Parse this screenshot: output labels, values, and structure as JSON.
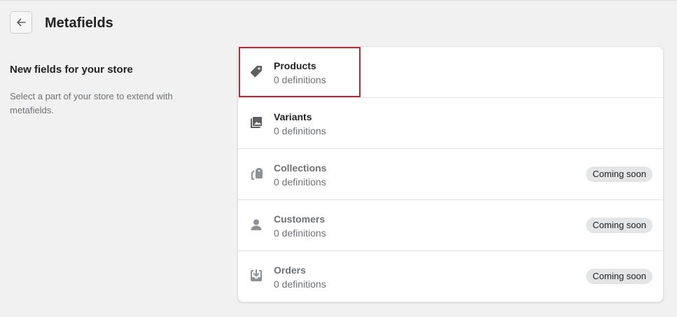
{
  "header": {
    "back_label": "Back",
    "title": "Metafields"
  },
  "section": {
    "heading": "New fields for your store",
    "description": "Select a part of your store to extend with metafields."
  },
  "items": [
    {
      "title": "Products",
      "subtitle": "0 definitions",
      "icon": "tag-icon",
      "enabled": true,
      "badge": ""
    },
    {
      "title": "Variants",
      "subtitle": "0 definitions",
      "icon": "variants-icon",
      "enabled": true,
      "badge": ""
    },
    {
      "title": "Collections",
      "subtitle": "0 definitions",
      "icon": "collections-icon",
      "enabled": false,
      "badge": "Coming soon"
    },
    {
      "title": "Customers",
      "subtitle": "0 definitions",
      "icon": "customer-icon",
      "enabled": false,
      "badge": "Coming soon"
    },
    {
      "title": "Orders",
      "subtitle": "0 definitions",
      "icon": "orders-icon",
      "enabled": false,
      "badge": "Coming soon"
    }
  ],
  "colors": {
    "background": "#f1f1f1",
    "highlight": "#c4262e",
    "icon_enabled": "#5c5f62",
    "icon_disabled": "#8c9196"
  }
}
